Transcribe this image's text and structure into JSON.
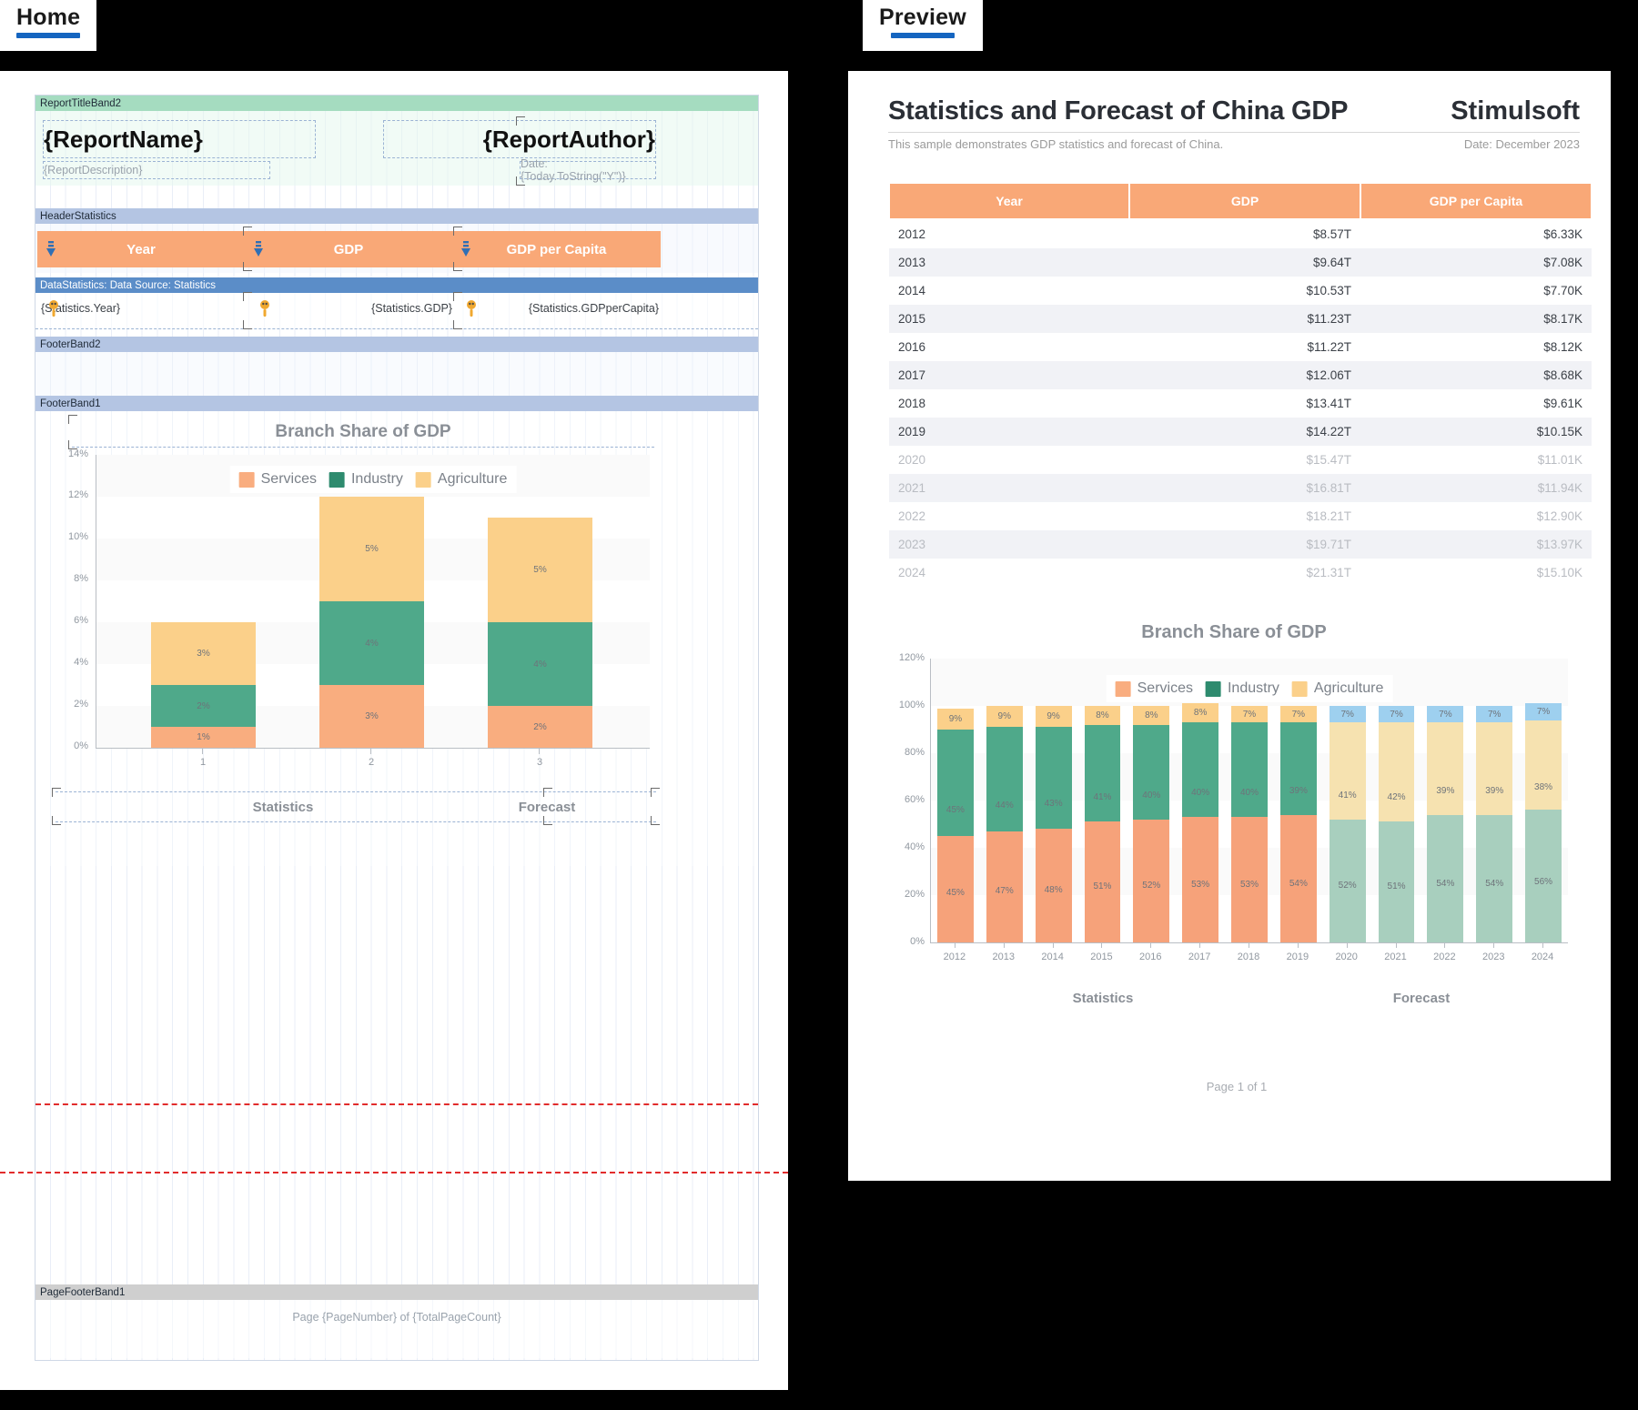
{
  "tabs": [
    {
      "id": "home",
      "label": "Home"
    },
    {
      "id": "preview",
      "label": "Preview"
    }
  ],
  "colors": {
    "services": "#f6a27a",
    "industry": "#4fa98a",
    "agriculture": "#fbd08a",
    "forecast_services": "#a8cfbe",
    "forecast_agriculture": "#f6e2b0",
    "forecast_industry": "#9ed0ef",
    "header_orange": "#f9a877",
    "tab_underline": "#1565c0",
    "band_title": "#a5dcc0",
    "band_header": "#b4c5e3",
    "band_data": "#5b8dc8",
    "band_pagefooter": "#cfcfcf"
  },
  "designer": {
    "bands": [
      {
        "name": "ReportTitleBand2",
        "style": "green"
      },
      {
        "name": "HeaderStatistics",
        "style": "blue"
      },
      {
        "name": "DataStatistics: Data Source: Statistics",
        "style": "blue-dark"
      },
      {
        "name": "FooterBand2",
        "style": "blue"
      },
      {
        "name": "FooterBand1",
        "style": "blue"
      },
      {
        "name": "PageFooterBand1",
        "style": "grey"
      }
    ],
    "title_band": {
      "report_name": "{ReportName}",
      "report_author": "{ReportAuthor}",
      "report_description": "{ReportDescription}",
      "date_expression": "Date: {Today.ToString(\"Y\")}"
    },
    "header_columns": [
      "Year",
      "GDP",
      "GDP per Capita"
    ],
    "data_fields": [
      "{Statistics.Year}",
      "{Statistics.GDP}",
      "{Statistics.GDPperCapita}"
    ],
    "page_footer": "Page {PageNumber} of {TotalPageCount}",
    "chart": {
      "title": "Branch Share of GDP",
      "legend": [
        "Services",
        "Industry",
        "Agriculture"
      ],
      "group_labels": [
        "Statistics",
        "Forecast"
      ]
    }
  },
  "preview": {
    "report_title": "Statistics and Forecast of China GDP",
    "brand": "Stimulsoft",
    "description": "This sample demonstrates GDP statistics and forecast of China.",
    "date": "Date: December 2023",
    "table": {
      "columns": [
        "Year",
        "GDP",
        "GDP per Capita"
      ],
      "rows": [
        {
          "year": "2012",
          "gdp": "$8.57T",
          "per_capita": "$6.33K",
          "forecast": false
        },
        {
          "year": "2013",
          "gdp": "$9.64T",
          "per_capita": "$7.08K",
          "forecast": false
        },
        {
          "year": "2014",
          "gdp": "$10.53T",
          "per_capita": "$7.70K",
          "forecast": false
        },
        {
          "year": "2015",
          "gdp": "$11.23T",
          "per_capita": "$8.17K",
          "forecast": false
        },
        {
          "year": "2016",
          "gdp": "$11.22T",
          "per_capita": "$8.12K",
          "forecast": false
        },
        {
          "year": "2017",
          "gdp": "$12.06T",
          "per_capita": "$8.68K",
          "forecast": false
        },
        {
          "year": "2018",
          "gdp": "$13.41T",
          "per_capita": "$9.61K",
          "forecast": false
        },
        {
          "year": "2019",
          "gdp": "$14.22T",
          "per_capita": "$10.15K",
          "forecast": false
        },
        {
          "year": "2020",
          "gdp": "$15.47T",
          "per_capita": "$11.01K",
          "forecast": true
        },
        {
          "year": "2021",
          "gdp": "$16.81T",
          "per_capita": "$11.94K",
          "forecast": true
        },
        {
          "year": "2022",
          "gdp": "$18.21T",
          "per_capita": "$12.90K",
          "forecast": true
        },
        {
          "year": "2023",
          "gdp": "$19.71T",
          "per_capita": "$13.97K",
          "forecast": true
        },
        {
          "year": "2024",
          "gdp": "$21.31T",
          "per_capita": "$15.10K",
          "forecast": true
        }
      ]
    },
    "page_footer": "Page 1 of 1"
  },
  "chart_data": [
    {
      "id": "preview_chart",
      "type": "bar",
      "stacked": true,
      "title": "Branch Share of GDP",
      "xlabel": "",
      "ylabel": "",
      "ylim": [
        0,
        120
      ],
      "yticks": [
        "0%",
        "20%",
        "40%",
        "60%",
        "80%",
        "100%",
        "120%"
      ],
      "grid": true,
      "legend": [
        "Services",
        "Industry",
        "Agriculture"
      ],
      "legend_position": "top-center",
      "categories": [
        "2012",
        "2013",
        "2014",
        "2015",
        "2016",
        "2017",
        "2018",
        "2019",
        "2020",
        "2021",
        "2022",
        "2023",
        "2024"
      ],
      "group_annotations": [
        {
          "label": "Statistics",
          "from": "2012",
          "to": "2019"
        },
        {
          "label": "Forecast",
          "from": "2020",
          "to": "2024"
        }
      ],
      "series": [
        {
          "name": "Services",
          "values": [
            45,
            47,
            48,
            51,
            52,
            53,
            53,
            54,
            52,
            51,
            54,
            54,
            56
          ]
        },
        {
          "name": "Industry",
          "values": [
            45,
            44,
            43,
            41,
            40,
            40,
            40,
            39,
            41,
            42,
            39,
            39,
            38
          ]
        },
        {
          "name": "Agriculture",
          "values": [
            9,
            9,
            9,
            8,
            8,
            8,
            7,
            7,
            7,
            7,
            7,
            7,
            7
          ]
        }
      ],
      "forecast_from": "2020"
    },
    {
      "id": "designer_chart",
      "type": "bar",
      "stacked": true,
      "title": "Branch Share of GDP",
      "xlabel": "",
      "ylabel": "",
      "ylim": [
        0,
        14
      ],
      "yticks": [
        "0%",
        "2%",
        "4%",
        "6%",
        "8%",
        "10%",
        "12%",
        "14%"
      ],
      "grid": true,
      "legend": [
        "Services",
        "Industry",
        "Agriculture"
      ],
      "legend_position": "top-center",
      "categories": [
        "1",
        "2",
        "3"
      ],
      "group_annotations": [
        {
          "label": "Statistics"
        },
        {
          "label": "Forecast"
        }
      ],
      "series": [
        {
          "name": "Services",
          "values": [
            1,
            3,
            2
          ]
        },
        {
          "name": "Industry",
          "values": [
            2,
            4,
            4
          ]
        },
        {
          "name": "Agriculture",
          "values": [
            3,
            5,
            5
          ]
        }
      ]
    }
  ]
}
